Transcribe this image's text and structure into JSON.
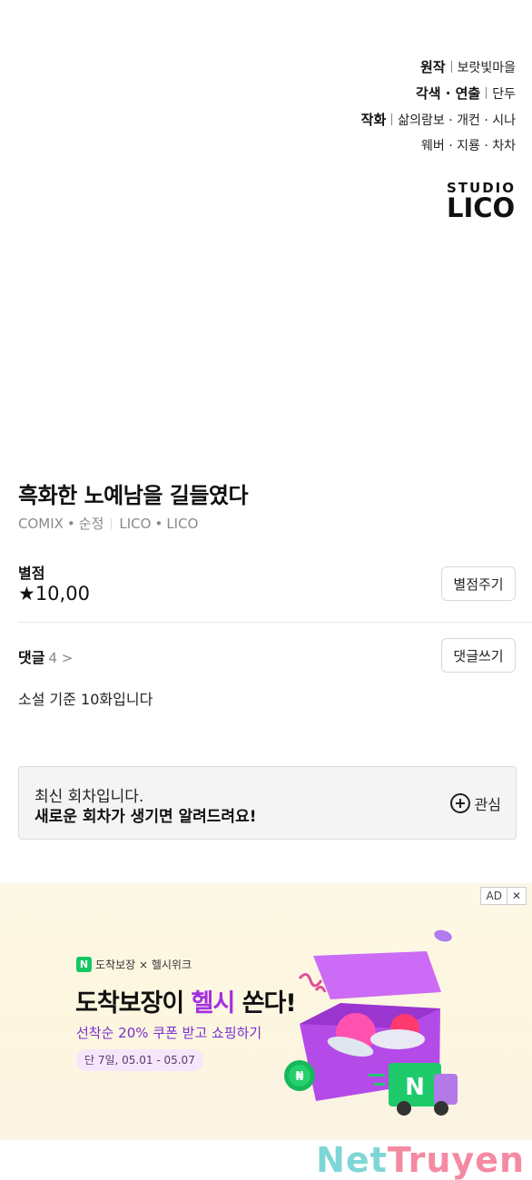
{
  "credits": [
    {
      "role": "원작",
      "names": "보랏빛마을"
    },
    {
      "role": "각색 · 연출",
      "names": "단두"
    },
    {
      "role": "작화",
      "names": "삶의람보 · 개컨 · 시나"
    },
    {
      "role": "",
      "names": "웨버 · 지룡 · 차차"
    }
  ],
  "studio": {
    "line1": "STUDIO",
    "line2": "LICO"
  },
  "series": {
    "title": "흑화한 노예남을 길들였다",
    "publisher": "COMIX",
    "genre": "순정",
    "author": "LICO",
    "artist": "LICO"
  },
  "rating": {
    "label": "별점",
    "value": "★10,00",
    "rate_button": "별점주기"
  },
  "comments": {
    "label": "댓글",
    "count": "4 >",
    "write_button": "댓글쓰기",
    "top_comment": "소설 기준 10화입니다"
  },
  "notify": {
    "line1": "최신 회차입니다.",
    "line2": "새로운 회차가 생기면 알려드려요!",
    "follow_label": "관심"
  },
  "ad": {
    "badge": "AD",
    "close": "✕",
    "brand": "도착보장 × 헬시위크",
    "brand_icon": "N",
    "headline_pre": "도착보장이 ",
    "headline_highlight": "헬시",
    "headline_post": " 쏜다!",
    "sub": "선착순 20% 쿠폰 받고 쇼핑하기",
    "date": "단 7일, 05.01 - 05.07",
    "accent_color": "#a430e0",
    "truck_letter": "N"
  },
  "watermark": {
    "part1": "Net",
    "part2": "Truyen"
  }
}
